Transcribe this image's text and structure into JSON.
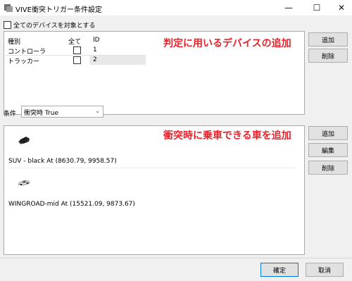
{
  "window": {
    "title": "VIVE衝突トリガー条件設定",
    "controls": {
      "minimize": "—",
      "maximize": "☐",
      "close": "✕"
    },
    "app_icon": "app-icon"
  },
  "all_devices_label": "全てのデバイスを対象とする",
  "device_table": {
    "headers": {
      "type": "種別",
      "all": "全て",
      "id": "ID"
    },
    "rows": [
      {
        "type": "コントローラ",
        "id": "1"
      },
      {
        "type": "トラッカー",
        "id": "2"
      }
    ]
  },
  "annotations": {
    "device": "判定に用いるデバイスの追加",
    "car": "衝突時に乗車できる車を追加"
  },
  "annotation_color": "#e8232b",
  "device_buttons": {
    "add": "追加",
    "delete": "削除"
  },
  "condition": {
    "label": "条件",
    "value": "衝突時 True"
  },
  "cars": [
    {
      "label": "SUV - black At (8630.79, 9958.57)",
      "icon": "suv-car-icon"
    },
    {
      "label": "WINGROAD-mid At (15521.09, 9873.67)",
      "icon": "wingroad-car-icon"
    }
  ],
  "car_buttons": {
    "add": "追加",
    "edit": "編集",
    "delete": "削除"
  },
  "footer": {
    "ok": "確定",
    "cancel": "取消"
  }
}
